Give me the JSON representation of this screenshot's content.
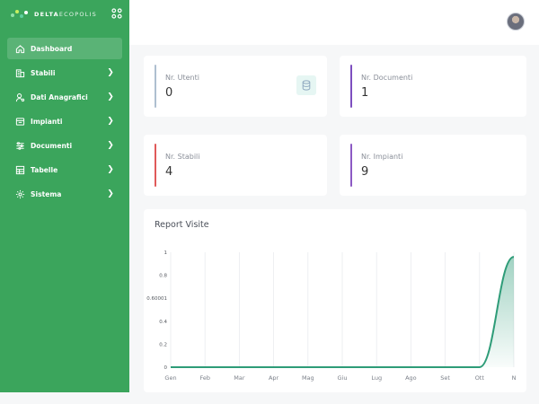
{
  "brand": {
    "name_bold": "DELTA",
    "name_light": "ECOPOLIS"
  },
  "sidebar": {
    "items": [
      {
        "label": "Dashboard",
        "icon": "home-icon",
        "active": true,
        "chevron": false
      },
      {
        "label": "Stabili",
        "icon": "building-icon",
        "active": false,
        "chevron": true
      },
      {
        "label": "Dati Anagrafici",
        "icon": "person-icon",
        "active": false,
        "chevron": true
      },
      {
        "label": "Impianti",
        "icon": "panel-icon",
        "active": false,
        "chevron": true
      },
      {
        "label": "Documenti",
        "icon": "sliders-icon",
        "active": false,
        "chevron": true
      },
      {
        "label": "Tabelle",
        "icon": "table-icon",
        "active": false,
        "chevron": true
      },
      {
        "label": "Sistema",
        "icon": "gear-icon",
        "active": false,
        "chevron": true
      }
    ]
  },
  "stats": [
    {
      "label": "Nr. Utenti",
      "value": "0",
      "color": "#aebfd0",
      "icon": "database-icon"
    },
    {
      "label": "Nr. Documenti",
      "value": "1",
      "color": "#7d4fbf"
    },
    {
      "label": "Nr. Stabili",
      "value": "4",
      "color": "#e05a5a"
    },
    {
      "label": "Nr. Impianti",
      "value": "9",
      "color": "#8c5ac4"
    }
  ],
  "chart": {
    "title": "Report Visite"
  },
  "chart_data": {
    "type": "area",
    "categories": [
      "Gen",
      "Feb",
      "Mar",
      "Apr",
      "Mag",
      "Giu",
      "Lug",
      "Ago",
      "Set",
      "Ott",
      "N"
    ],
    "yticks": [
      "1",
      "0.8",
      "0.60001",
      "0.4",
      "0.2",
      "0"
    ],
    "ylim": [
      0,
      1
    ],
    "series": [
      {
        "values": [
          0,
          0,
          0,
          0,
          0,
          0,
          0,
          0,
          0,
          0,
          0.96
        ]
      }
    ],
    "grid": "vertical",
    "line_color": "#2e9c78"
  }
}
